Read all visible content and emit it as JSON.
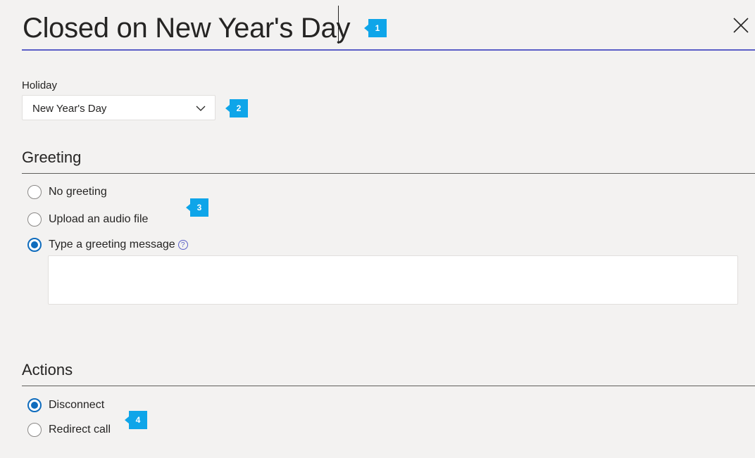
{
  "header": {
    "title": "Closed on New Year's Day",
    "close_icon": "close-icon"
  },
  "holiday": {
    "label": "Holiday",
    "selected": "New Year's Day",
    "chevron_icon": "chevron-down-icon"
  },
  "greeting": {
    "heading": "Greeting",
    "options": [
      {
        "label": "No greeting",
        "checked": false
      },
      {
        "label": "Upload an audio file",
        "checked": false
      },
      {
        "label": "Type a greeting message",
        "checked": true
      }
    ],
    "help_icon": "help-icon",
    "message_value": ""
  },
  "actions": {
    "heading": "Actions",
    "options": [
      {
        "label": "Disconnect",
        "checked": true
      },
      {
        "label": "Redirect call",
        "checked": false
      }
    ]
  },
  "callouts": [
    "1",
    "2",
    "3",
    "4"
  ],
  "colors": {
    "accent": "#5b5fc7",
    "radio_checked": "#0f6cbd",
    "callout": "#0ea5e9",
    "background": "#f3f2f1"
  }
}
